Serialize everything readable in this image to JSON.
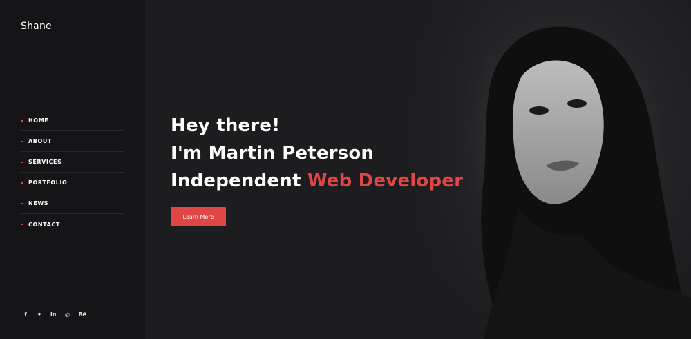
{
  "brand": {
    "name": "Shane"
  },
  "nav": {
    "items": [
      {
        "label": "HOME"
      },
      {
        "label": "ABOUT"
      },
      {
        "label": "SERVICES"
      },
      {
        "label": "PORTFOLIO"
      },
      {
        "label": "NEWS"
      },
      {
        "label": "CONTACT"
      }
    ]
  },
  "social": {
    "items": [
      {
        "icon": "facebook-icon",
        "glyph": "f"
      },
      {
        "icon": "twitter-icon",
        "glyph": "✦"
      },
      {
        "icon": "linkedin-icon",
        "glyph": "in"
      },
      {
        "icon": "instagram-icon",
        "glyph": "◎"
      },
      {
        "icon": "behance-icon",
        "glyph": "Bē"
      }
    ]
  },
  "hero": {
    "line1": "Hey there!",
    "line2": "I'm Martin Peterson",
    "line3_prefix": "Independent ",
    "line3_accent": "Web Developer",
    "cta_label": "Learn More"
  },
  "colors": {
    "accent": "#e04646",
    "sidebar_bg": "#151517",
    "hero_bg": "#1d1d20"
  }
}
